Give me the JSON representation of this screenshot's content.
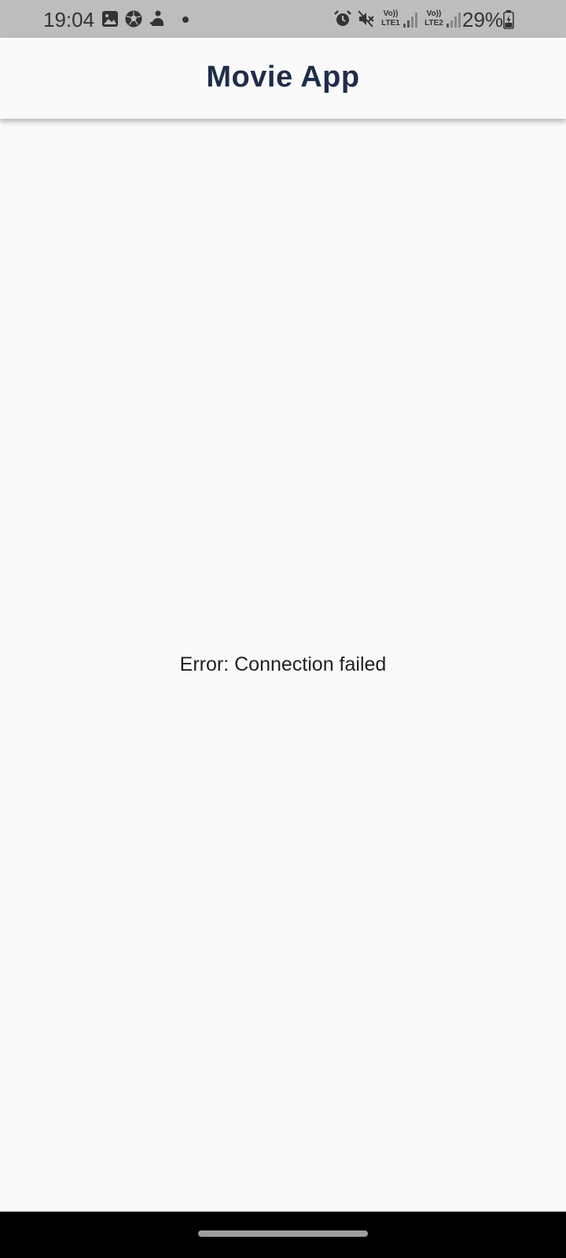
{
  "status_bar": {
    "time": "19:04",
    "left_icons": [
      "gallery-icon",
      "soccer-ball-icon",
      "app-notification-icon"
    ],
    "right_icons": [
      "alarm-icon",
      "mute-icon"
    ],
    "sim1": {
      "vo": "Vo))",
      "lte": "LTE1"
    },
    "sim2": {
      "vo": "Vo))",
      "lte": "LTE2"
    },
    "battery": "29%"
  },
  "app_bar": {
    "title": "Movie App",
    "title_color": "#1f2d4a"
  },
  "content": {
    "message": "Error: Connection failed"
  },
  "colors": {
    "status_bar_bg": "#bdbdbd",
    "background": "#fafafa",
    "nav_bar_bg": "#000000"
  }
}
